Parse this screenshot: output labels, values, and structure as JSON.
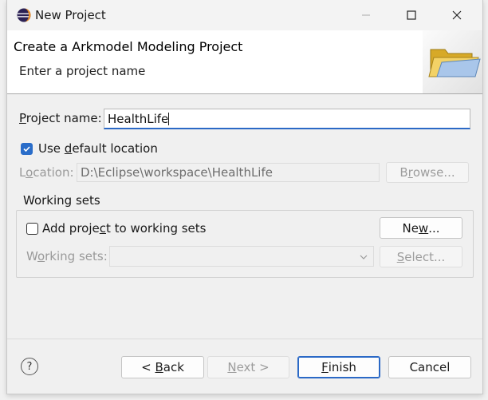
{
  "window": {
    "title": "New Project"
  },
  "header": {
    "title": "Create a Arkmodel Modeling Project",
    "description": "Enter a project name"
  },
  "project_name": {
    "label_pre": "",
    "label_mnemonic": "P",
    "label_post": "roject name:",
    "value": "HealthLife"
  },
  "use_default": {
    "label_pre": "Use ",
    "label_mnemonic": "d",
    "label_post": "efault location",
    "checked": true
  },
  "location": {
    "label_pre": "L",
    "label_mnemonic": "o",
    "label_post": "cation:",
    "value": "D:\\Eclipse\\workspace\\HealthLife",
    "browse_pre": "B",
    "browse_mnemonic": "r",
    "browse_post": "owse..."
  },
  "working_sets": {
    "group_label": "Working sets",
    "add_pre": "Add proje",
    "add_mnemonic": "c",
    "add_post": "t to working sets",
    "add_checked": false,
    "new_pre": "Ne",
    "new_mnemonic": "w",
    "new_post": "...",
    "sets_pre": "W",
    "sets_mnemonic": "o",
    "sets_post": "rking sets:",
    "select_pre": "",
    "select_mnemonic": "S",
    "select_post": "elect..."
  },
  "footer": {
    "help": "?",
    "back_pre": "< ",
    "back_mnemonic": "B",
    "back_post": "ack",
    "next_mnemonic": "N",
    "next_post": "ext >",
    "finish_mnemonic": "F",
    "finish_post": "inish",
    "cancel": "Cancel"
  },
  "colors": {
    "accent": "#2b69c6",
    "folder": "#e8c24a"
  }
}
